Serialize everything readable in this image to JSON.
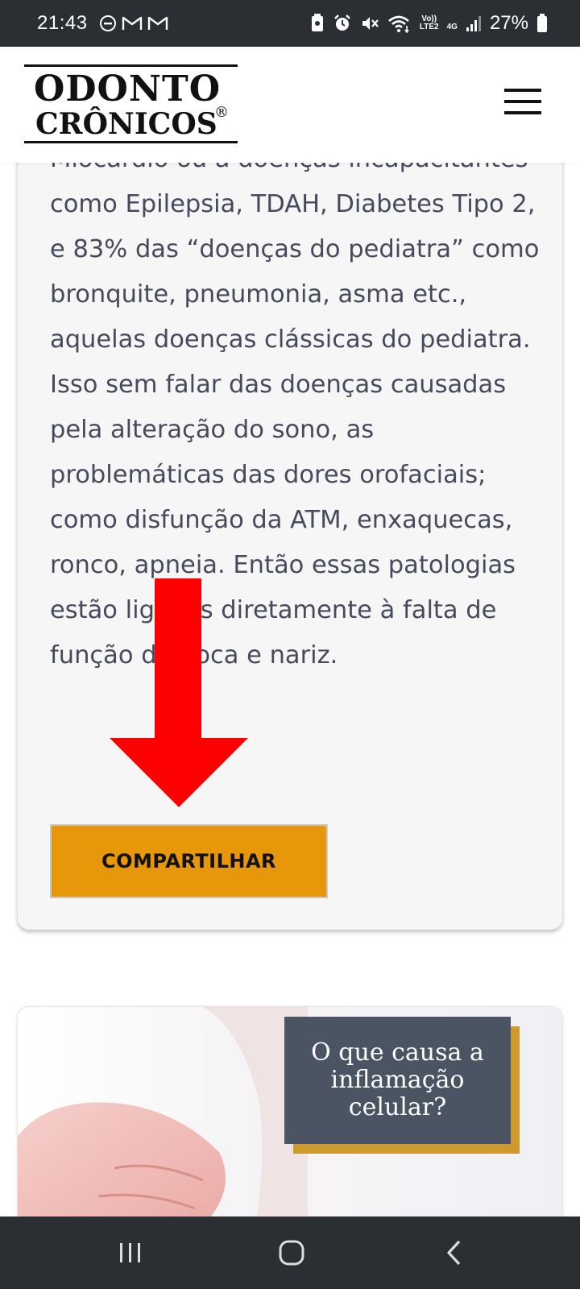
{
  "status_bar": {
    "time": "21:43",
    "battery": "27%",
    "network_label_top": "Vo))",
    "network_label_bottom": "LTE2",
    "network_gen": "4G",
    "icons": [
      "do-not-disturb-icon",
      "gmail-icon",
      "gmail-icon",
      "screenshot-icon",
      "alarm-icon",
      "mute-icon",
      "wifi-icon",
      "signal-icon",
      "battery-icon"
    ]
  },
  "header": {
    "logo_line1": "ODONTO",
    "logo_line2": "CRÔNICOS",
    "logo_mark": "®"
  },
  "article": {
    "body": "Miocárdio ou a doenças incapacitantes como Epilepsia, TDAH, Diabetes Tipo 2, e 83% das “doenças do pediatra” como bronquite, pneumonia, asma etc., aquelas doenças clássicas do pediatra. Isso sem falar das doenças causadas pela alteração do sono, as problemáticas das dores orofaciais; como disfunção da ATM, enxaquecas, ronco, apneia. Então essas patologias estão ligadas diretamente à falta de função da boca e nariz.",
    "share_label": "COMPARTILHAR"
  },
  "overlay": {
    "arrow_color": "#ff0000"
  },
  "next_card": {
    "title": "O que causa a inflamação celular?"
  },
  "colors": {
    "share_button": "#e6970a",
    "title_box": "#4a5462",
    "title_box_accent": "#cf9a2d",
    "body_text": "#474a5c"
  }
}
